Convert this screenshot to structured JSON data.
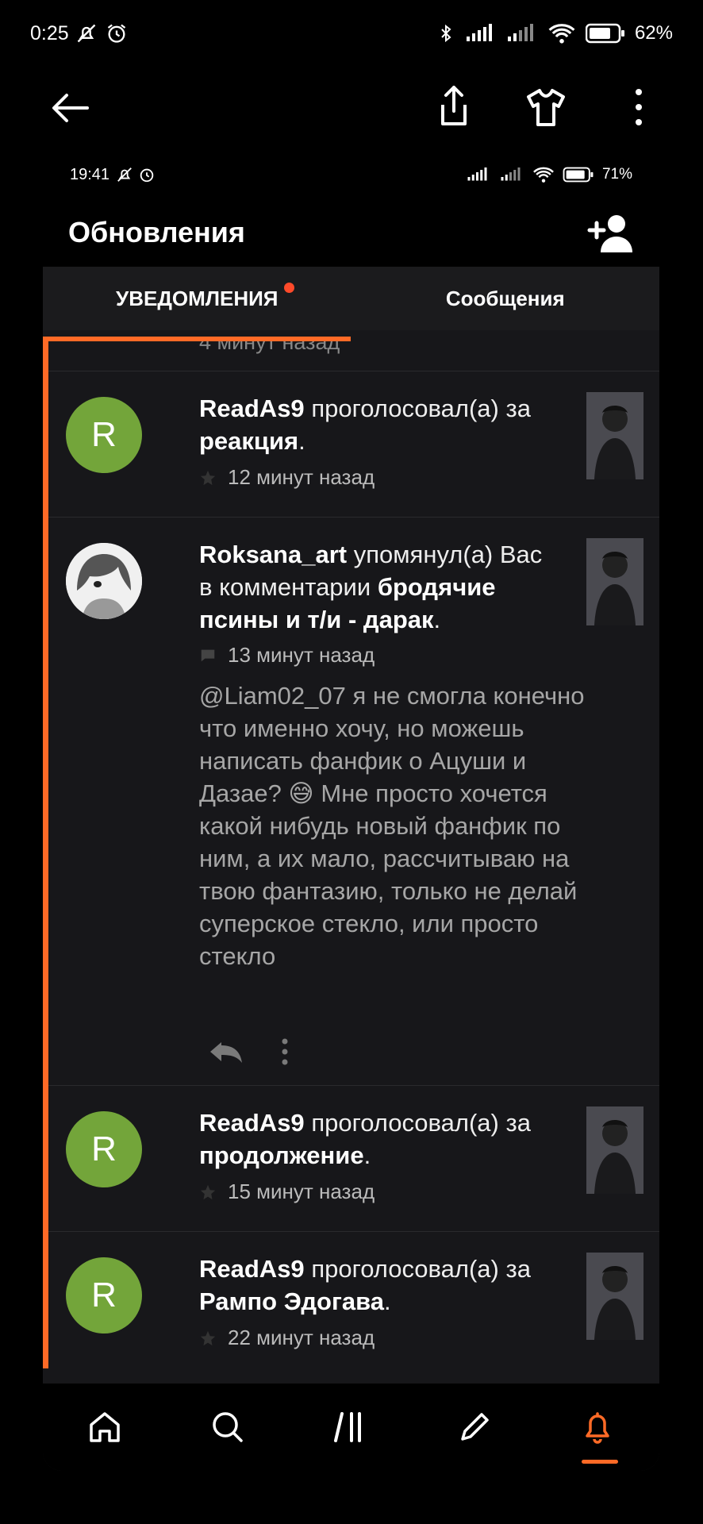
{
  "outer_status": {
    "time": "0:25",
    "battery": "62%"
  },
  "inner_status": {
    "time": "19:41",
    "battery": "71%"
  },
  "header": {
    "title": "Обновления"
  },
  "tabs": [
    {
      "label": "УВЕДОМЛЕНИЯ",
      "active": true,
      "has_dot": true
    },
    {
      "label": "Сообщения",
      "active": false
    }
  ],
  "partial_item": {
    "time": "4 минут назад"
  },
  "notifications": [
    {
      "user": "ReadAs9",
      "action": "проголосовал(а) за",
      "target": "реакция",
      "suffix": ".",
      "time": "12 минут назад",
      "avatar_letter": "R"
    },
    {
      "user": "Roksana_art",
      "action": "упомянул(а) Вас в комментарии",
      "target": "бродячие псины и т/и - дарак",
      "suffix": ".",
      "time": "13 минут назад",
      "comment": "@Liam02_07 я не смогла конечно что именно хочу, но можешь написать фанфик о Ацуши и Дазае? 😅 Мне просто хочется какой нибудь новый фанфик по ним, а их мало, рассчитываю на твою фантазию, только не делай суперское стекло, или просто стекло"
    },
    {
      "user": "ReadAs9",
      "action": "проголосовал(а) за",
      "target": "продолжение",
      "suffix": ".",
      "time": "15 минут назад",
      "avatar_letter": "R"
    },
    {
      "user": "ReadAs9",
      "action": "проголосовал(а) за",
      "target": "Рампо Эдогава",
      "suffix": ".",
      "time": "22 минут назад",
      "avatar_letter": "R"
    }
  ],
  "colors": {
    "accent": "#ff6a26",
    "avatar_green": "#73a53a",
    "background": "#17171a"
  }
}
